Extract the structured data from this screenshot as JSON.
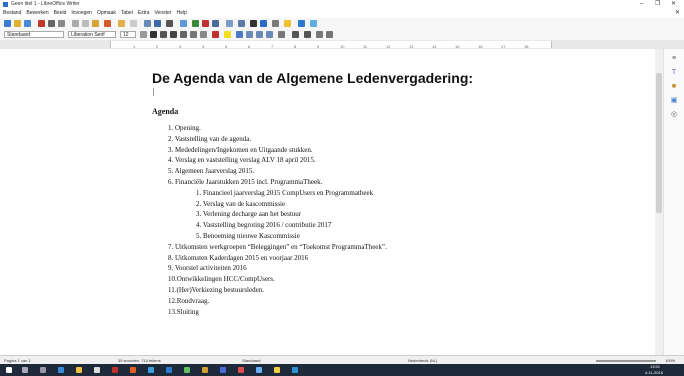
{
  "window": {
    "title": "Geen titel 1 - LibreOffice Writer",
    "minimize": "–",
    "maximize": "❐",
    "close": "✕"
  },
  "menu": [
    "Bestand",
    "Bewerken",
    "Beeld",
    "Invoegen",
    "Opmaak",
    "Tabel",
    "Extra",
    "Venster",
    "Help"
  ],
  "toolbar": {
    "style": "Standaard",
    "font": "Liberation Serif",
    "size": "12"
  },
  "ruler_ticks": [
    "1",
    "2",
    "3",
    "4",
    "5",
    "6",
    "7",
    "8",
    "9",
    "10",
    "11",
    "12",
    "13",
    "14",
    "15",
    "16",
    "17",
    "18"
  ],
  "document": {
    "heading": "De Agenda van de Algemene Ledenvergadering:",
    "subheading": "Agenda",
    "items": [
      "1.  Opening.",
      "2.  Vaststelling van de agenda.",
      "3.  Mededelingen/Ingekomen en Uitgaande stukken.",
      "4.  Verslag en vaststelling verslag ALV 18 april 2015.",
      "5.  Algemeen Jaarverslag 2015.",
      "6.  Financiële Jaarstukken 2015 incl. ProgrammaTheek."
    ],
    "subitems": [
      "1.  Financieel jaarverslag 2015 CompUsers en Programmatheek",
      "2.  Verslag van de kascommissie",
      "3.  Verlening decharge aan het bestuur",
      "4.  Vaststelling begroting 2016 / contributie 2017",
      "5.  Benoeming nieuwe Kascommissie"
    ],
    "items2": [
      "7.  Uitkomsten werkgroepen “Beleggingen” en “Toekomst ProgrammaTheek”.",
      "8.  Uitkomsten Kaderdagen 2015 en voorjaar 2016",
      "9.  Voorstel activiteiten 2016",
      "10.Ontwikkelingen HCC/CompUsers.",
      "11.(Her)Verkiezing bestuursleden.",
      "12.Rondvraag.",
      "13.Sluiting"
    ]
  },
  "status": {
    "page": "Pagina 1 van 1",
    "words": "35 woorden, 714 tekens",
    "style": "Standaard",
    "language": "Nederlands (NL)",
    "zoom": "100%"
  },
  "clock": {
    "time": "13:51",
    "date": "4-11-2016"
  }
}
